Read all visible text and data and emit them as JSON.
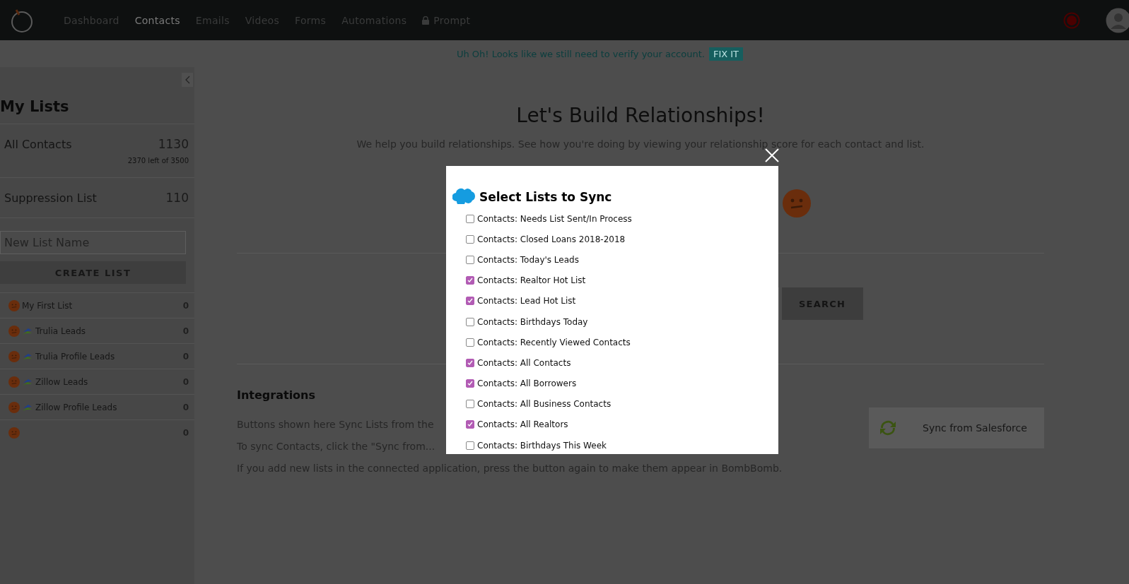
{
  "nav": {
    "items": [
      {
        "label": "Dashboard",
        "selected": false,
        "locked": false
      },
      {
        "label": "Contacts",
        "selected": true,
        "locked": false
      },
      {
        "label": "Emails",
        "selected": false,
        "locked": false
      },
      {
        "label": "Videos",
        "selected": false,
        "locked": false
      },
      {
        "label": "Forms",
        "selected": false,
        "locked": false
      },
      {
        "label": "Automations",
        "selected": false,
        "locked": false
      },
      {
        "label": "Prompt",
        "selected": false,
        "locked": true
      }
    ]
  },
  "banner": {
    "text": "Uh Oh! Looks like we still need to verify your account.",
    "button": "FIX IT"
  },
  "sidebar": {
    "title": "My Lists",
    "summary": [
      {
        "name": "All Contacts",
        "count": "1130",
        "note": "2370 left of 3500"
      },
      {
        "name": "Suppression List",
        "count": "110"
      }
    ],
    "new_list": {
      "placeholder": "New List Name"
    },
    "create_button": "CREATE LIST",
    "lists": [
      {
        "kind": "plain",
        "name": "My First List",
        "count": "0"
      },
      {
        "kind": "lead-source",
        "name": "Trulia Leads",
        "count": "0"
      },
      {
        "kind": "lead-source",
        "name": "Trulia Profile Leads",
        "count": "0"
      },
      {
        "kind": "lead-source",
        "name": "Zillow Leads",
        "count": "0"
      },
      {
        "kind": "lead-source",
        "name": "Zillow Profile Leads",
        "count": "0"
      },
      {
        "kind": "plain",
        "count": "0"
      }
    ]
  },
  "main": {
    "title": "Let's Build Relationships!",
    "subtitle": "We help you build relationships. See how you're doing by viewing your relationship score for each contact and list.",
    "search_button": "SEARCH",
    "integrations": {
      "title": "Integrations",
      "lines": [
        "Buttons shown here Sync Lists from the",
        "To sync Contacts, click the \"Sync from...",
        "If you add new lists in the connected application, press the button again to make them appear in BombBomb."
      ],
      "sync_button": "Sync from Salesforce"
    }
  },
  "modal": {
    "title": "Select Lists to Sync",
    "options": [
      {
        "label": "Contacts: Needs List Sent/In Process",
        "checked": false
      },
      {
        "label": "Contacts: Closed Loans 2018-2018",
        "checked": false
      },
      {
        "label": "Contacts: Today's Leads",
        "checked": false
      },
      {
        "label": "Contacts: Realtor Hot List",
        "checked": true
      },
      {
        "label": "Contacts: Lead Hot List",
        "checked": true
      },
      {
        "label": "Contacts: Birthdays Today",
        "checked": false
      },
      {
        "label": "Contacts: Recently Viewed Contacts",
        "checked": false
      },
      {
        "label": "Contacts: All Contacts",
        "checked": true
      },
      {
        "label": "Contacts: All Borrowers",
        "checked": true
      },
      {
        "label": "Contacts: All Business Contacts",
        "checked": false
      },
      {
        "label": "Contacts: All Realtors",
        "checked": true
      },
      {
        "label": "Contacts: Birthdays This Week",
        "checked": false
      }
    ]
  }
}
